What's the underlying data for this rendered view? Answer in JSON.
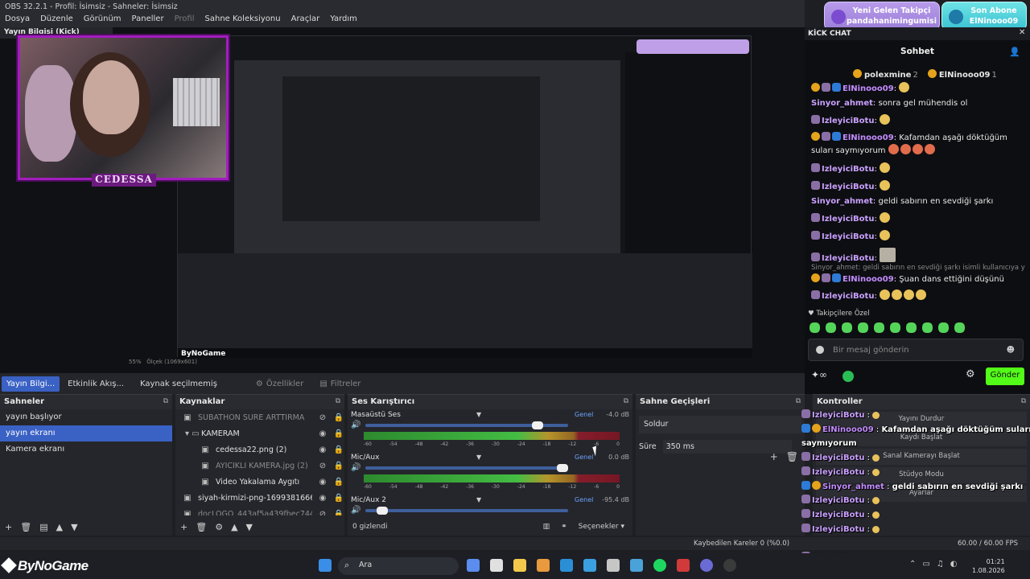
{
  "titlebar": {
    "title": "OBS 32.2.1 - Profil: İsimsiz - Sahneler: İsimsiz"
  },
  "menubar": [
    "Dosya",
    "Düzenle",
    "Görünüm",
    "Paneller",
    "Profil",
    "Sahne Koleksiyonu",
    "Araçlar",
    "Yardım"
  ],
  "preview": {
    "dock_title": "Yayın Bilgisi (Kick)",
    "cam_label": "CEDESSA",
    "zoom": "55%",
    "resolution": "Ölçek (1069x601)",
    "nested_brand": "ByNoGame"
  },
  "alerts": {
    "follower_title": "Yeni Gelen Takipçi",
    "follower_name": "pandahanimingumisi",
    "sub_title": "Son Abone",
    "sub_name": "ElNinooo09"
  },
  "scenebar": {
    "tabs": [
      "Yayın Bilgi...",
      "Etkinlik Akış..."
    ],
    "no_source": "Kaynak seçilmemiş",
    "properties": "Özellikler",
    "filters": "Filtreler"
  },
  "scenes": {
    "title": "Sahneler",
    "items": [
      "yayın başlıyor",
      "yayın ekranı",
      "Kamera ekranı"
    ],
    "selected": 1
  },
  "sources": {
    "title": "Kaynaklar",
    "items": [
      {
        "name": "SUBATHON SÜRE ARTTIRMA",
        "dim": true
      },
      {
        "name": "KAMERAM",
        "dim": false
      },
      {
        "name": "cedessa22.png (2)",
        "dim": false
      },
      {
        "name": "AYICIKLI KAMERA.jpg (2)",
        "dim": true
      },
      {
        "name": "Video Yakalama Aygıtı",
        "dim": false
      },
      {
        "name": "siyah-kirmizi-png-1699381666070.pn",
        "dim": false
      },
      {
        "name": "docLOGO_443af5a439fbec74418f6a",
        "dim": true
      }
    ]
  },
  "mixer": {
    "title": "Ses Karıştırıcı",
    "channels": [
      {
        "name": "Masaüstü Ses",
        "mode": "Genel",
        "db": "-4.0 dB",
        "level": 0.87
      },
      {
        "name": "Mic/Aux",
        "mode": "Genel",
        "db": "0.0 dB",
        "level": 1.0
      },
      {
        "name": "Mic/Aux 2",
        "mode": "Genel",
        "db": "-95.4 dB",
        "level": 0.06
      }
    ],
    "ticks": [
      "-60",
      "-54",
      "-48",
      "-42",
      "-36",
      "-30",
      "-24",
      "-18",
      "-12",
      "-6",
      "0"
    ],
    "hidden": "0 gizlendi",
    "options": "Seçenekler"
  },
  "transitions": {
    "title": "Sahne Geçişleri",
    "selected": "Soldur",
    "duration_label": "Süre",
    "duration": "350 ms"
  },
  "controls": {
    "title": "Kontroller",
    "buttons": [
      "Yayını Durdur",
      "Kaydı Başlat",
      "Sanal Kamerayı Başlat",
      "Stüdyo Modu",
      "Ayarlar"
    ]
  },
  "status": {
    "dropped": "Kaybedilen Kareler 0 (%0.0)",
    "fps": "60.00 / 60.00 FPS"
  },
  "chat": {
    "dock_title": "KİCK CHAT",
    "header": "Sohbet",
    "pinned": [
      {
        "name": "polexmine",
        "count": "2"
      },
      {
        "name": "ElNinooo09",
        "count": "1"
      }
    ],
    "messages": [
      {
        "user": "ElNinooo09",
        "text": ""
      },
      {
        "user": "Sinyor_ahmet",
        "text": "sonra gel mühendis ol"
      },
      {
        "user": "IzleyiciBotu",
        "text": ""
      },
      {
        "user": "ElNinooo09",
        "text": "Kafamdan aşağı döktüğüm suları saymıyorum"
      },
      {
        "user": "IzleyiciBotu",
        "text": ""
      },
      {
        "user": "IzleyiciBotu",
        "text": ""
      },
      {
        "user": "Sinyor_ahmet",
        "text": "geldi sabırın en sevdiği şarkı"
      },
      {
        "user": "IzleyiciBotu",
        "text": ""
      },
      {
        "user": "IzleyiciBotu",
        "text": ""
      },
      {
        "user": "IzleyiciBotu",
        "text": ""
      },
      {
        "user": "ElNinooo09",
        "text": "Şuan dans ettiğini düşünü"
      },
      {
        "user": "IzleyiciBotu",
        "text": ""
      }
    ],
    "reply_line": "Sinyor_ahmet: geldi sabırın en sevdiği şarkı isimli kullanıcıya ya...",
    "subscribers_only": "Takipçilere Özel",
    "input_placeholder": "Bir mesaj gönderin",
    "send": "Gönder"
  },
  "overlay_chat": [
    {
      "user": "IzleyiciBotu",
      "text": ""
    },
    {
      "user": "ElNinooo09",
      "text": "Kafamdan aşağı döktüğüm suları"
    },
    {
      "user": "",
      "text": "saymıyorum"
    },
    {
      "user": "IzleyiciBotu",
      "text": ""
    },
    {
      "user": "IzleyiciBotu",
      "text": ""
    },
    {
      "user": "Sinyor_ahmet",
      "text": "geldi sabırın en sevdiği şarkı"
    },
    {
      "user": "IzleyiciBotu",
      "text": ""
    },
    {
      "user": "IzleyiciBotu",
      "text": ""
    },
    {
      "user": "IzleyiciBotu",
      "text": ""
    },
    {
      "user": "ElNinooo09",
      "text": "Şuan dans ettiğini düşünü"
    },
    {
      "user": "IzleyiciBotu",
      "text": ""
    }
  ],
  "taskbar": {
    "brand": "ByNoGame",
    "search": "Ara",
    "time": "01:21",
    "date": "1.08.2026"
  }
}
